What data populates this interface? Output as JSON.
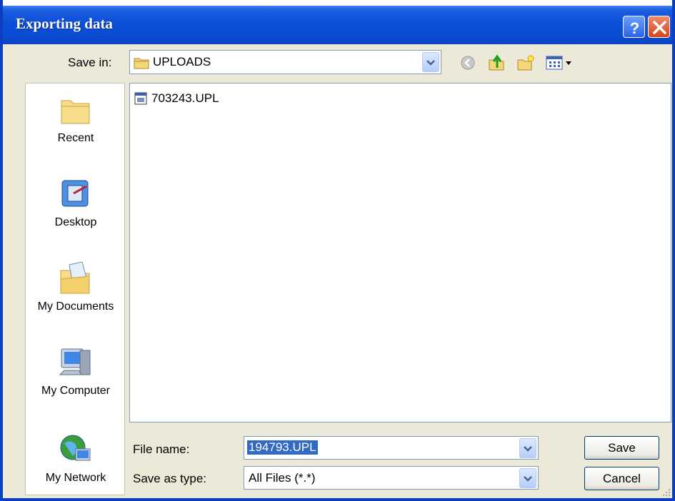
{
  "window": {
    "title": "Exporting data"
  },
  "titlebar_buttons": {
    "help_icon": "help-question-icon",
    "close_icon": "close-x-icon"
  },
  "save_in": {
    "label": "Save in:",
    "value": "UPLOADS",
    "icon": "folder-icon"
  },
  "toolbar": {
    "icons": [
      "back-arrow-icon",
      "up-folder-icon",
      "new-folder-icon",
      "view-menu-icon"
    ]
  },
  "places": [
    {
      "label": "Recent",
      "icon": "recent-folder-icon"
    },
    {
      "label": "Desktop",
      "icon": "desktop-icon"
    },
    {
      "label": "My Documents",
      "icon": "my-documents-icon"
    },
    {
      "label": "My Computer",
      "icon": "my-computer-icon"
    },
    {
      "label": "My Network",
      "icon": "my-network-icon"
    }
  ],
  "files": [
    {
      "name": "703243.UPL",
      "icon": "file-icon"
    }
  ],
  "file_name": {
    "label": "File name:",
    "value": "194793.UPL"
  },
  "save_as_type": {
    "label": "Save as type:",
    "value": "All Files  (*.*)"
  },
  "buttons": {
    "save": "Save",
    "cancel": "Cancel"
  },
  "colors": {
    "titlebar": "#0a4bd2",
    "dialog_bg": "#ece9d8",
    "selection": "#316ac5"
  }
}
